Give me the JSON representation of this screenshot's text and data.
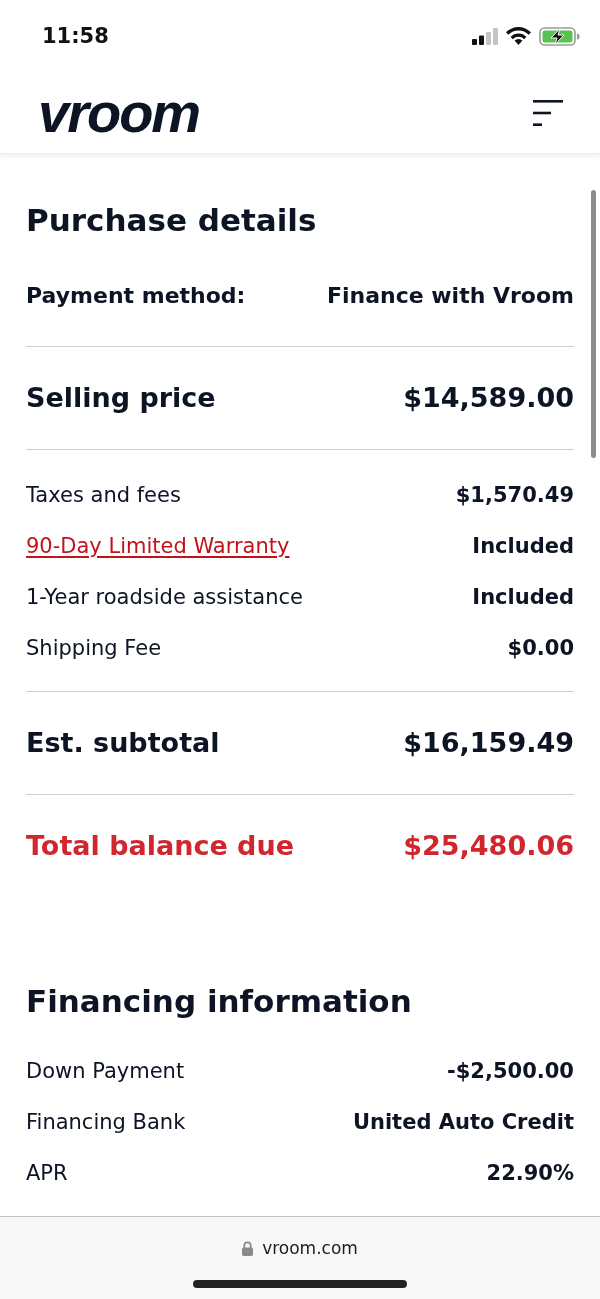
{
  "status_bar": {
    "time": "11:58"
  },
  "header": {
    "logo": "vroom"
  },
  "purchase_details": {
    "title": "Purchase details",
    "groups": [
      {
        "rows": [
          {
            "kind": "method",
            "label": "Payment method:",
            "value": "Finance with Vroom"
          }
        ]
      },
      {
        "rows": [
          {
            "kind": "major",
            "label": "Selling price",
            "value": "$14,589.00"
          }
        ]
      },
      {
        "rows": [
          {
            "kind": "item",
            "label": "Taxes and fees",
            "value": "$1,570.49"
          },
          {
            "kind": "link",
            "label": "90-Day Limited Warranty",
            "value": "Included"
          },
          {
            "kind": "item",
            "label": "1-Year roadside assistance",
            "value": "Included"
          },
          {
            "kind": "item",
            "label": "Shipping Fee",
            "value": "$0.00"
          }
        ]
      },
      {
        "rows": [
          {
            "kind": "major",
            "label": "Est. subtotal",
            "value": "$16,159.49"
          }
        ]
      },
      {
        "rows": [
          {
            "kind": "total",
            "label": "Total balance due",
            "value": "$25,480.06"
          }
        ]
      }
    ]
  },
  "financing_information": {
    "title": "Financing information",
    "rows": [
      {
        "kind": "item",
        "label": "Down Payment",
        "value": "-$2,500.00"
      },
      {
        "kind": "item",
        "label": "Financing Bank",
        "value": "United Auto Credit"
      },
      {
        "kind": "item",
        "label": "APR",
        "value": "22.90%"
      }
    ]
  },
  "browser_bar": {
    "url": "vroom.com"
  }
}
